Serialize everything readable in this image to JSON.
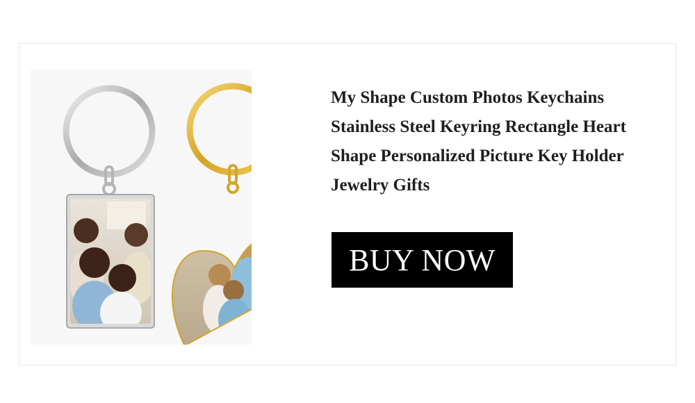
{
  "product": {
    "title": "My Shape Custom Photos Keychains Stainless Steel Keyring Rectangle Heart Shape Personalized Picture Key Holder Jewelry Gifts",
    "image_icon": "keychain-photo-icon"
  },
  "cta": {
    "buy_label": "BUY NOW"
  },
  "colors": {
    "silver": "#c9c9c9",
    "gold": "#e2b93b",
    "button_bg": "#000000",
    "button_text": "#ffffff",
    "title_text": "#1f1f1f"
  }
}
